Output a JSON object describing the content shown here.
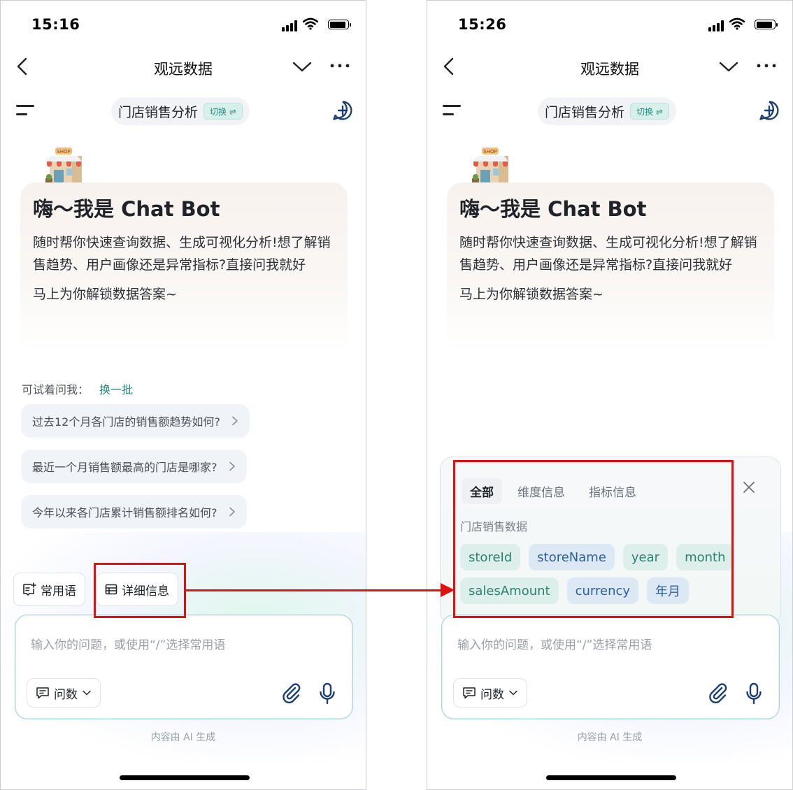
{
  "left_screen": {
    "status_time": "15:16",
    "nav_title": "观远数据",
    "topic": "门店销售分析",
    "switch_label": "切换 ⇌",
    "welcome_title": "嗨～我是 Chat Bot",
    "welcome_desc": "随时帮你快速查询数据、生成可视化分析!想了解销售趋势、用户画像还是异常指标?直接问我就好",
    "welcome_sub": "马上为你解锁数据答案~",
    "try_label": "可试着问我：",
    "try_refresh": "换一批",
    "suggestions": [
      "过去12个月各门店的销售额趋势如何?",
      "最近一个月销售额最高的门店是哪家?",
      "今年以来各门店累计销售额排名如何?"
    ],
    "quick_phrases_label": "常用语",
    "details_label": "详细信息",
    "input_placeholder": "输入你的问题，或使用“/”选择常用语",
    "mode_label": "问数",
    "footer_note": "内容由 AI 生成"
  },
  "right_screen": {
    "status_time": "15:26",
    "nav_title": "观远数据",
    "topic": "门店销售分析",
    "switch_label": "切换 ⇌",
    "welcome_title": "嗨～我是 Chat Bot",
    "welcome_desc": "随时帮你快速查询数据、生成可视化分析!想了解销售趋势、用户画像还是异常指标?直接问我就好",
    "welcome_sub": "马上为你解锁数据答案~",
    "info_tabs": [
      "全部",
      "维度信息",
      "指标信息"
    ],
    "dataset_name": "门店销售数据",
    "fields_row1": [
      "storeId",
      "storeName",
      "year",
      "month"
    ],
    "fields_row2": [
      "salesAmount",
      "currency",
      "年月"
    ],
    "input_placeholder": "输入你的问题，或使用“/”选择常用语",
    "mode_label": "问数",
    "footer_note": "内容由 AI 生成"
  },
  "colors": {
    "accent": "#1f8a7a",
    "annotation": "#e01010",
    "dim_tag": "#dcefea",
    "metric_tag": "#dde8f5"
  }
}
